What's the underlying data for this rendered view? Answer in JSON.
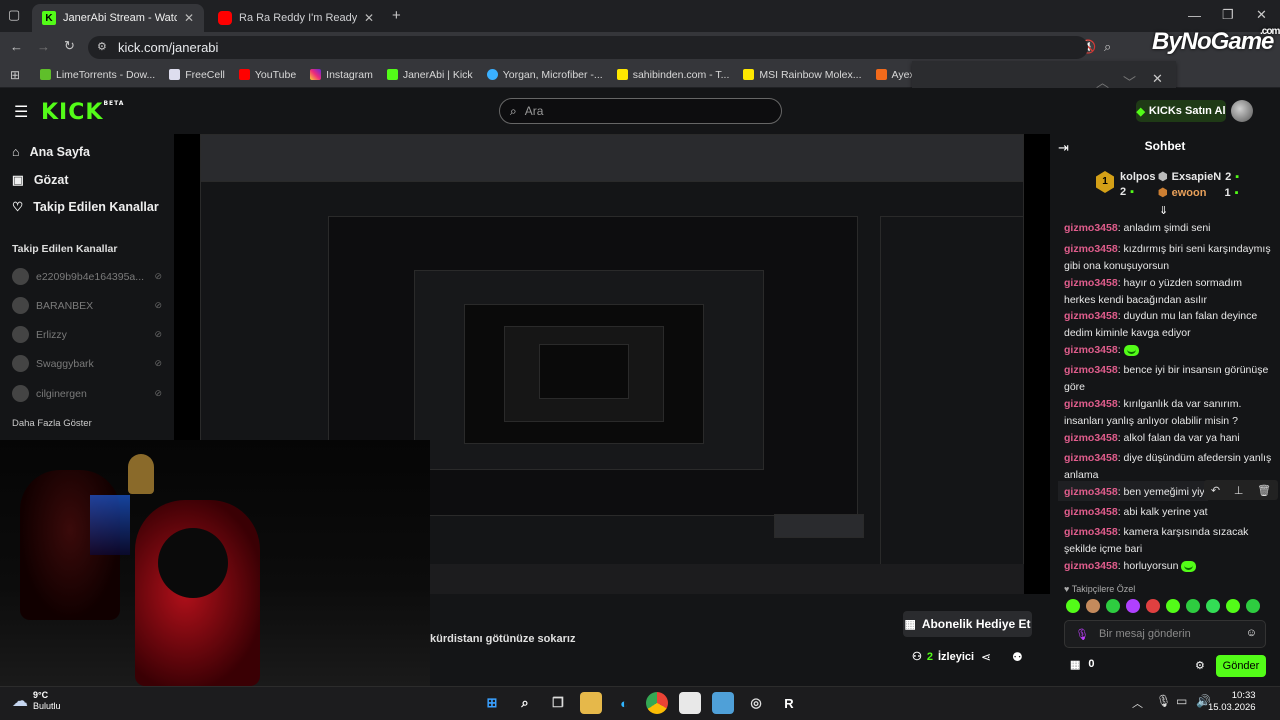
{
  "browser": {
    "tabs": [
      {
        "title": "JanerAbi Stream - Watch Live o",
        "favicon": "K",
        "active": true
      },
      {
        "title": "Ra Ra Reddy I'm Ready Video S",
        "favicon": "yt",
        "active": false
      }
    ],
    "new_tab_label": "+",
    "url": "kick.com/janerabi",
    "bookmarks": [
      "LimeTorrents - Dow...",
      "FreeCell",
      "YouTube",
      "Instagram",
      "JanerAbi | Kick",
      "Yorgan, Microfiber -...",
      "sahibinden.com - T...",
      "MSI Rainbow Molex...",
      "Ayex Vidalı Kelepçe..."
    ]
  },
  "watermark": {
    "text": "ByNoGame",
    "suffix": ".com"
  },
  "kick": {
    "logo": "KICK",
    "logo_badge": "BETA",
    "search_placeholder": "Ara",
    "buy_kicks": "KICKs Satın Al",
    "nav": [
      {
        "label": "Ana Sayfa",
        "icon": "home-icon"
      },
      {
        "label": "Gözat",
        "icon": "browse-icon"
      },
      {
        "label": "Takip Edilen Kanallar",
        "icon": "heart-icon"
      }
    ],
    "followed_title": "Takip Edilen Kanallar",
    "channels": [
      "e2209b9b4e164395a...",
      "BARANBEX",
      "Erlizzy",
      "Swaggybark",
      "cilginergen"
    ],
    "show_more": "Daha Fazla Göster",
    "stream_title_fragment": "kürdistanı götünüze sokarız",
    "sub_gift": "Abonelik Hediye Et",
    "viewers_count": "2",
    "viewers_label": "İzleyici"
  },
  "chat": {
    "title": "Sohbet",
    "leaderboard": [
      {
        "name": "kolpos",
        "count": "2"
      },
      {
        "name": "ExsapieN",
        "count": "2"
      },
      {
        "name": "ewoon",
        "count": "1"
      }
    ],
    "messages": [
      {
        "user": "gizmo3458",
        "text": "anladım şimdi seni"
      },
      {
        "user": "gizmo3458",
        "text": "kızdırmış biri seni karşındaymış gibi ona konuşuyorsun"
      },
      {
        "user": "gizmo3458",
        "text": "hayır o yüzden sormadım herkes kendi bacağından asılır"
      },
      {
        "user": "gizmo3458",
        "text": "duydun mu lan falan deyince dedim kiminle kavga ediyor"
      },
      {
        "user": "gizmo3458",
        "text": ""
      },
      {
        "user": "gizmo3458",
        "text": "bence iyi bir insansın görünüşe göre"
      },
      {
        "user": "gizmo3458",
        "text": "kırılganlık da var sanırım. insanları yanlış anlıyor olabilir misin ?"
      },
      {
        "user": "gizmo3458",
        "text": "alkol falan da var ya hani"
      },
      {
        "user": "gizmo3458",
        "text": "diye düşündüm afedersin yanlış anlama"
      },
      {
        "user": "gizmo3458",
        "text": "ben yemeğimi yiyeyim"
      },
      {
        "user": "gizmo3458",
        "text": "abi kalk yerine yat"
      },
      {
        "user": "gizmo3458",
        "text": "kamera karşısında sızacak şekilde içme bari"
      },
      {
        "user": "gizmo3458",
        "text": "horluyorsun"
      }
    ],
    "followers_emotes_label": "Takipçilere Özel",
    "input_placeholder": "Bir mesaj gönderin",
    "kicks_count": "0",
    "send_label": "Gönder"
  },
  "taskbar": {
    "weather_temp": "9°C",
    "weather_desc": "Bulutlu",
    "time": "10:33",
    "date": "15.03.2026"
  },
  "colors": {
    "kick_green": "#53fc18",
    "username": "#e05d8c",
    "bg": "#141517"
  }
}
